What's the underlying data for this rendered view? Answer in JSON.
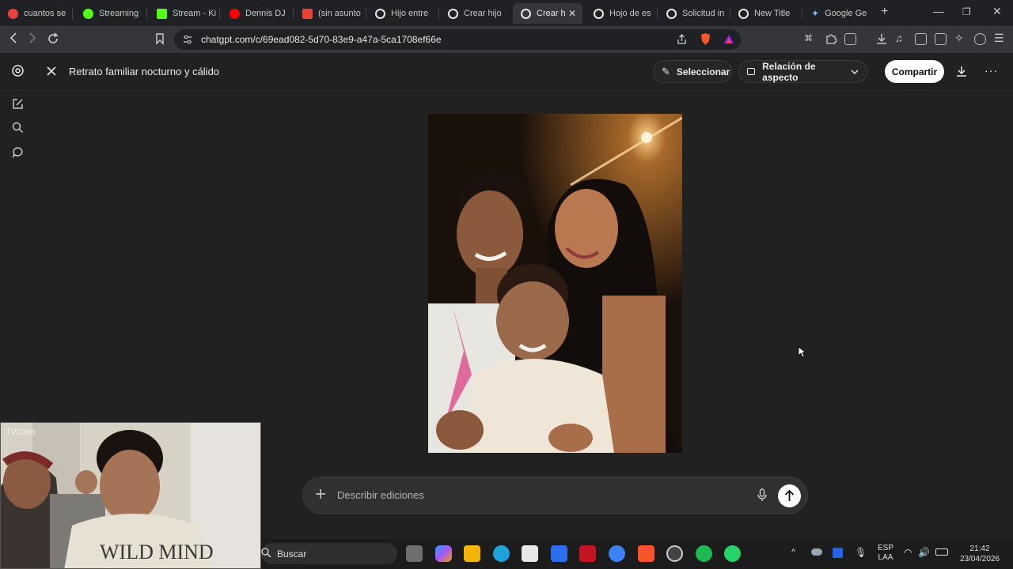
{
  "browser": {
    "tabs": [
      {
        "label": "cuantos se",
        "favicon": "#e84040"
      },
      {
        "label": "Streaming",
        "favicon": "#53fc18"
      },
      {
        "label": "Stream - Ki",
        "favicon": "#53fc18"
      },
      {
        "label": "Dennis DJ",
        "favicon": "#ff0000"
      },
      {
        "label": "(sin asunto",
        "favicon": "#ea4335"
      },
      {
        "label": "Hijo entre",
        "favicon": "#e8e8e8"
      },
      {
        "label": "Crear hijo",
        "favicon": "#e8e8e8"
      },
      {
        "label": "Crear h",
        "favicon": "#e8e8e8",
        "active": true
      },
      {
        "label": "Hojo de es",
        "favicon": "#e8e8e8"
      },
      {
        "label": "Solicitud in",
        "favicon": "#e8e8e8"
      },
      {
        "label": "New Title",
        "favicon": "#e8e8e8"
      },
      {
        "label": "Google Ge",
        "favicon": "#8ab4f8"
      }
    ],
    "new_tab": "+",
    "url": "chatgpt.com/c/69ead082-5d70-83e9-a47a-5ca1708ef66e",
    "window_controls": {
      "minimize": "—",
      "restore": "❐",
      "close": "✕"
    }
  },
  "app": {
    "title": "Retrato familiar nocturno y cálido",
    "select_label": "Seleccionar",
    "aspect_label": "Relación de aspecto",
    "share_label": "Compartir",
    "composer_placeholder": "Describir ediciones"
  },
  "webcam": {
    "overlay_text": "TVCam"
  },
  "taskbar": {
    "search_label": "Buscar",
    "lang_top": "ESP",
    "lang_bottom": "LAA",
    "time": "21:42",
    "date": "23/04/2026"
  },
  "icons": {
    "back": "chevron-left-icon",
    "forward": "chevron-right-icon",
    "reload": "reload-icon",
    "close_view": "close-icon",
    "download": "download-icon",
    "more": "more-icon"
  }
}
